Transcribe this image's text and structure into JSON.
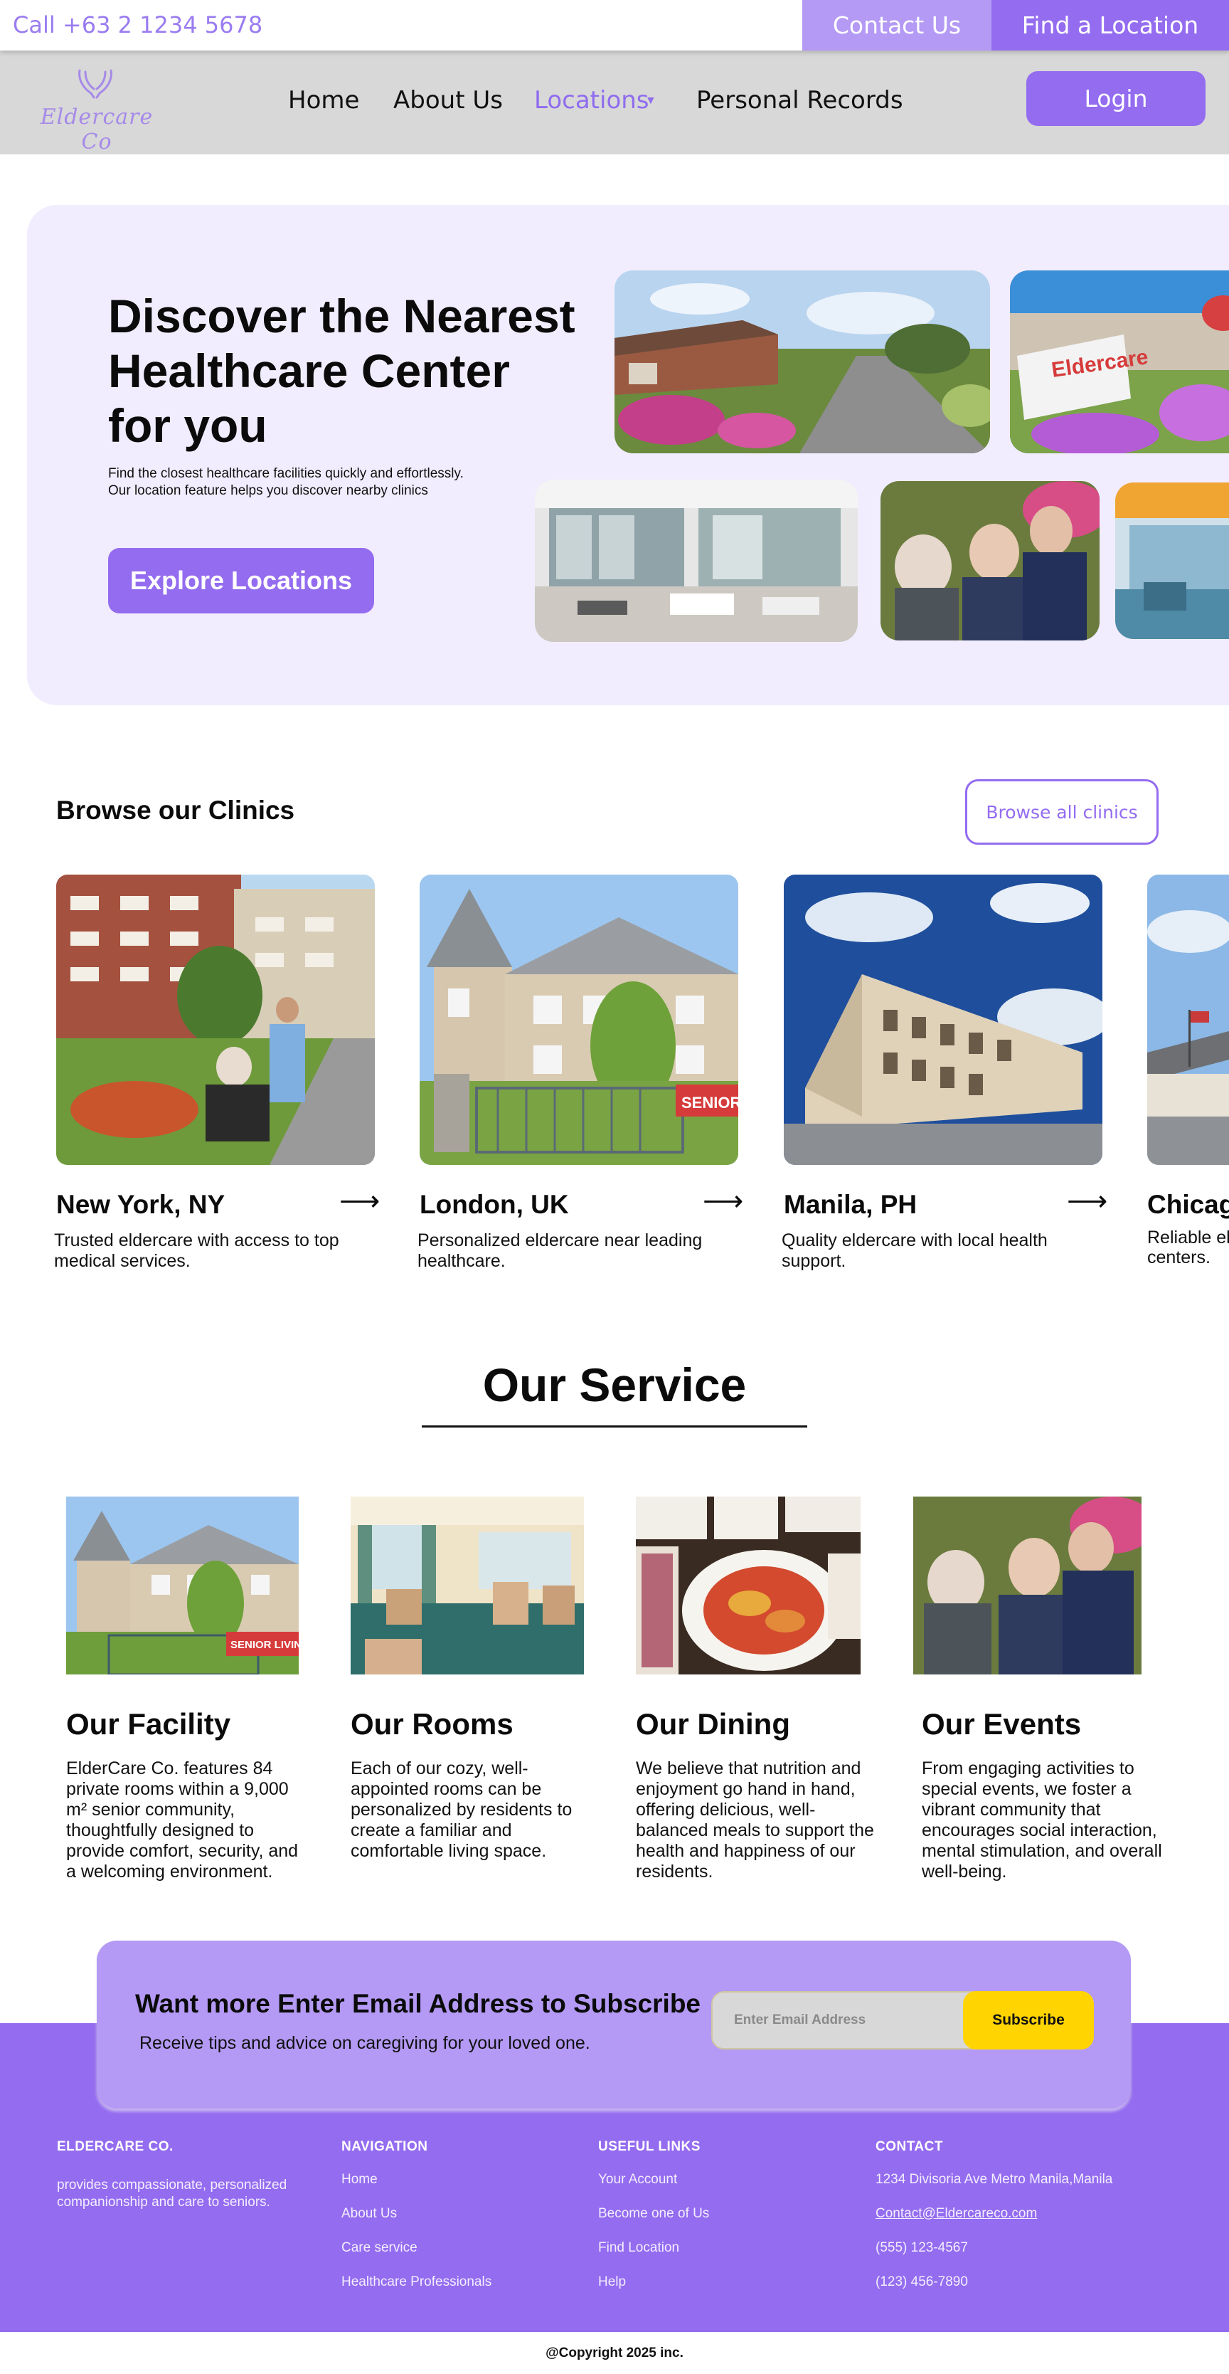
{
  "topbar": {
    "phone": "Call +63 2 1234 5678",
    "contact_label": "Contact Us",
    "find_label": "Find a Location"
  },
  "nav": {
    "logo_text": "Eldercare Co",
    "items": [
      {
        "label": "Home"
      },
      {
        "label": "About Us"
      },
      {
        "label": "Locations"
      },
      {
        "label": "Personal Records"
      }
    ],
    "login_label": "Login"
  },
  "hero": {
    "title_lines": [
      "Discover the Nearest",
      "Healthcare Center",
      "for you"
    ],
    "subtitle_lines": [
      "Find the closest healthcare facilities quickly and effortlessly.",
      "Our location feature helps you discover nearby clinics"
    ],
    "cta_label": "Explore Locations",
    "sign_text": "Eldercare"
  },
  "browse": {
    "title": "Browse our Clinics",
    "all_label": "Browse all clinics",
    "clinics": [
      {
        "city": "New York, NY",
        "desc": "Trusted eldercare with access to top medical services."
      },
      {
        "city": "London, UK",
        "desc": "Personalized eldercare near leading healthcare."
      },
      {
        "city": "Manila, PH",
        "desc": "Quality eldercare with local health support."
      },
      {
        "city": "Chicag",
        "desc_lines": [
          "Reliable el",
          "centers."
        ]
      }
    ],
    "banner_text": "SENIOR"
  },
  "service": {
    "title": "Our Service",
    "banner_text": "SENIOR LIVING",
    "items": [
      {
        "name": "Our Facility",
        "text": "ElderCare Co. features 84 private rooms within a 9,000 m² senior community, thoughtfully designed to provide comfort, security, and a welcoming environment."
      },
      {
        "name": "Our Rooms",
        "text": "Each of our cozy, well-appointed rooms can be personalized by residents to create a familiar and comfortable living space."
      },
      {
        "name": "Our Dining",
        "text": "We believe that nutrition and enjoyment go hand in hand, offering delicious, well-balanced meals to support the health and happiness of our residents."
      },
      {
        "name": "Our Events",
        "text": "From engaging activities to special events, we foster a vibrant community that encourages social interaction, mental stimulation, and overall well-being."
      }
    ]
  },
  "subscribe": {
    "title": "Want more Enter Email Address to Subscribe",
    "text": "Receive tips and advice on caregiving for your loved one.",
    "placeholder": "Enter Email Address",
    "button_label": "Subscribe"
  },
  "footer": {
    "brand": "ELDERCARE CO.",
    "about": "provides compassionate, personalized companionship and care to seniors.",
    "navigation": {
      "head": "NAVIGATION",
      "items": [
        "Home",
        "About Us",
        "Care service",
        "Healthcare Professionals"
      ]
    },
    "useful": {
      "head": "USEFUL LINKS",
      "items": [
        "Your Account",
        "Become one of Us",
        "Find Location",
        "Help"
      ]
    },
    "contact": {
      "head": "CONTACT",
      "items": [
        "1234 Divisoria Ave Metro Manila,Manila",
        "Contact@Eldercareco.com",
        "(555) 123-4567",
        "(123) 456-7890"
      ]
    },
    "copyright": "@Copyright 2025 inc."
  },
  "colors": {
    "accent": "#946cf0",
    "accent_light": "#b49af5",
    "hero_bg": "#f1edfe",
    "nav_bg": "#d8d8d8",
    "subscribe_button": "#ffd400"
  }
}
